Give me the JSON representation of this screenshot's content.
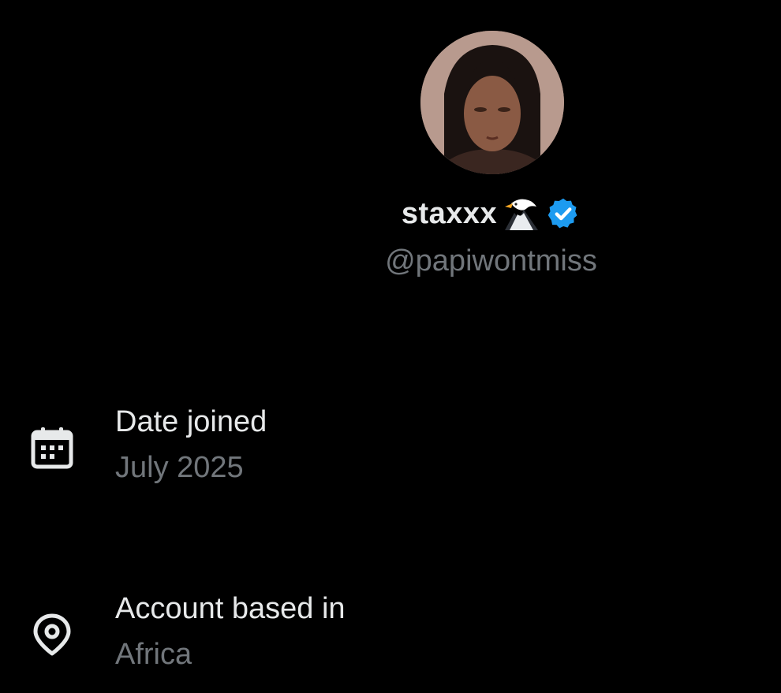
{
  "profile": {
    "display_name": "staxxx",
    "handle": "@papiwontmiss",
    "name_emoji": "eagle-icon",
    "verified": true,
    "verified_color": "#1d9bf0"
  },
  "about": {
    "items": [
      {
        "icon": "calendar-icon",
        "label": "Date joined",
        "value": "July 2025"
      },
      {
        "icon": "location-pin-icon",
        "label": "Account based in",
        "value": "Africa"
      }
    ]
  },
  "colors": {
    "background": "#000000",
    "primary_text": "#e7e9ea",
    "secondary_text": "#71767b"
  }
}
